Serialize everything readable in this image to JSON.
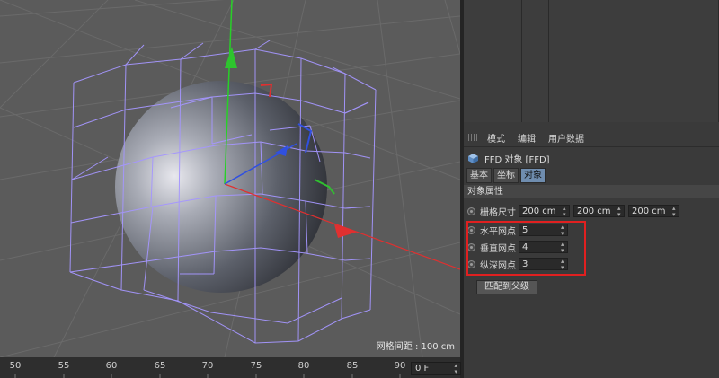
{
  "viewport": {
    "grid_spacing_label": "网格间距 : 100 cm"
  },
  "attribute_manager": {
    "menu": [
      "模式",
      "编辑",
      "用户数据"
    ],
    "object_title": "FFD 对象 [FFD]",
    "tabs": [
      {
        "label": "基本",
        "active": false
      },
      {
        "label": "坐标",
        "active": false
      },
      {
        "label": "对象",
        "active": true
      }
    ],
    "section_title": "对象属性",
    "grid_size": {
      "label": "栅格尺寸",
      "x": "200 cm",
      "y": "200 cm",
      "z": "200 cm"
    },
    "points": [
      {
        "label": "水平网点",
        "value": "5"
      },
      {
        "label": "垂直网点",
        "value": "4"
      },
      {
        "label": "纵深网点",
        "value": "3"
      }
    ],
    "match_button": "匹配到父级"
  },
  "timeline": {
    "ticks": [
      "50",
      "55",
      "60",
      "65",
      "70",
      "75",
      "80",
      "85",
      "90"
    ],
    "current_frame": "0 F"
  },
  "colors": {
    "highlight": "#e02020",
    "tab_active": "#6f8daf",
    "lattice": "#a596ff"
  }
}
